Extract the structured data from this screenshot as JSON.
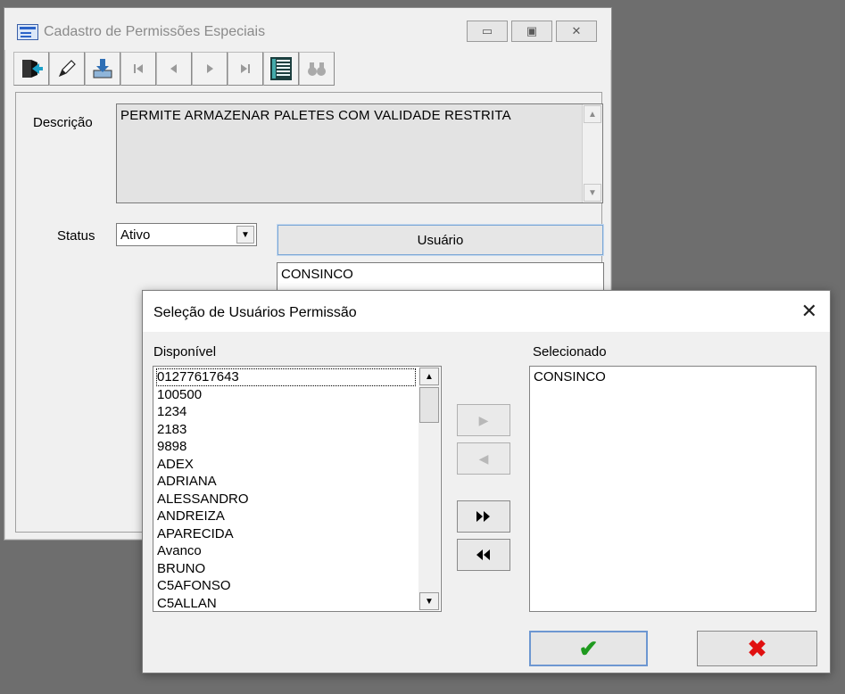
{
  "main_window": {
    "title": "Cadastro de Permissões Especiais",
    "caption_buttons": {
      "minimize": "▭",
      "maximize": "▣",
      "close": "✕"
    },
    "toolbar": {
      "buttons": [
        {
          "name": "exit",
          "icon": "exit-door-icon"
        },
        {
          "name": "edit",
          "icon": "pencil-icon"
        },
        {
          "name": "save",
          "icon": "save-download-icon"
        },
        {
          "name": "first",
          "icon": "first-record-icon"
        },
        {
          "name": "prev",
          "icon": "previous-record-icon"
        },
        {
          "name": "next",
          "icon": "next-record-icon"
        },
        {
          "name": "last",
          "icon": "last-record-icon"
        },
        {
          "name": "grid",
          "icon": "grid-list-icon"
        },
        {
          "name": "search",
          "icon": "binoculars-icon"
        }
      ]
    },
    "descricao_label": "Descrição",
    "descricao_value": "PERMITE ARMAZENAR PALETES COM VALIDADE RESTRITA",
    "status_label": "Status",
    "status_value": "Ativo",
    "usuario_button": "Usuário",
    "usuario_list": [
      "CONSINCO"
    ]
  },
  "dialog": {
    "title": "Seleção de Usuários Permissão",
    "disponivel_label": "Disponível",
    "selecionado_label": "Selecionado",
    "disponivel_items": [
      "01277617643",
      "100500",
      "1234",
      "2183",
      "9898",
      "ADEX",
      "ADRIANA",
      "ALESSANDRO",
      "ANDREIZA",
      "APARECIDA",
      "Avanco",
      "BRUNO",
      "C5AFONSO",
      "C5ALLAN"
    ],
    "selecionado_items": [
      "CONSINCO"
    ],
    "move_buttons": {
      "add_one": "▶",
      "remove_one": "◀",
      "add_all": "⏩",
      "remove_all": "⏪"
    },
    "ok_symbol": "✔",
    "cancel_symbol": "✖",
    "colors": {
      "ok": "#1f9a1f",
      "cancel": "#e01010"
    }
  }
}
